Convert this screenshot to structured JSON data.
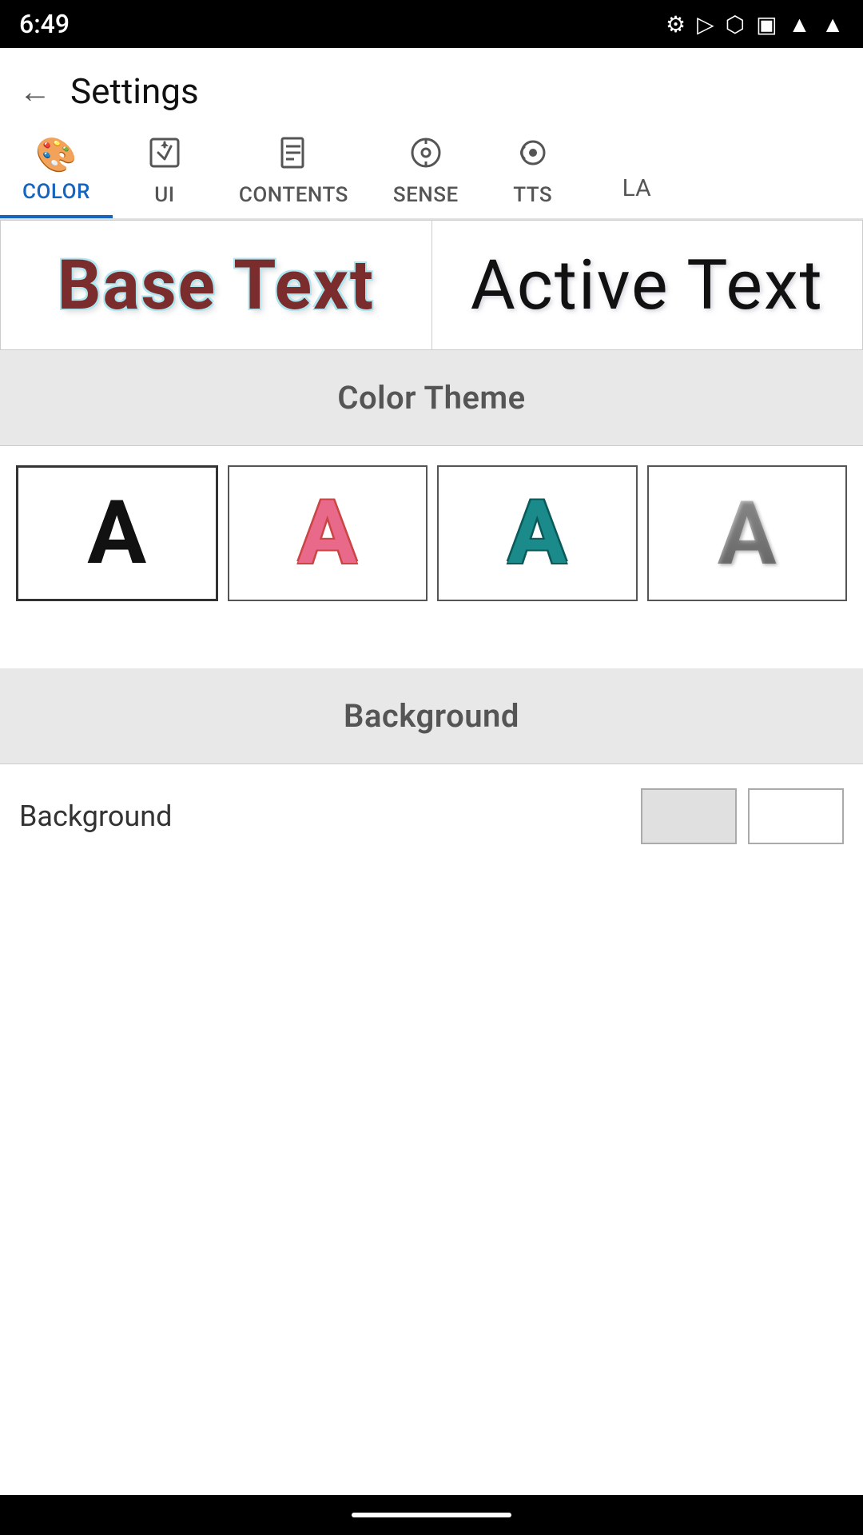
{
  "statusBar": {
    "time": "6:49",
    "icons": [
      "gear",
      "play",
      "person",
      "sim"
    ]
  },
  "header": {
    "backLabel": "←",
    "title": "Settings"
  },
  "tabs": [
    {
      "id": "color",
      "label": "COLOR",
      "icon": "🎨",
      "active": true
    },
    {
      "id": "ui",
      "label": "UI",
      "icon": "⬇",
      "active": false
    },
    {
      "id": "contents",
      "label": "CONTENTS",
      "icon": "📄",
      "active": false
    },
    {
      "id": "sense",
      "label": "SENSE",
      "icon": "⊙",
      "active": false
    },
    {
      "id": "tts",
      "label": "TTS",
      "icon": "📡",
      "active": false
    },
    {
      "id": "la",
      "label": "LA",
      "icon": "",
      "active": false
    }
  ],
  "preview": {
    "baseText": "Base Text",
    "activeText": "Active Text"
  },
  "colorTheme": {
    "sectionTitle": "Color Theme",
    "options": [
      {
        "id": "black",
        "letter": "A",
        "style": "black"
      },
      {
        "id": "pink",
        "letter": "A",
        "style": "pink"
      },
      {
        "id": "teal",
        "letter": "A",
        "style": "teal"
      },
      {
        "id": "gradient",
        "letter": "A",
        "style": "gradient"
      }
    ]
  },
  "background": {
    "sectionTitle": "Background",
    "rowLabel": "Background"
  }
}
